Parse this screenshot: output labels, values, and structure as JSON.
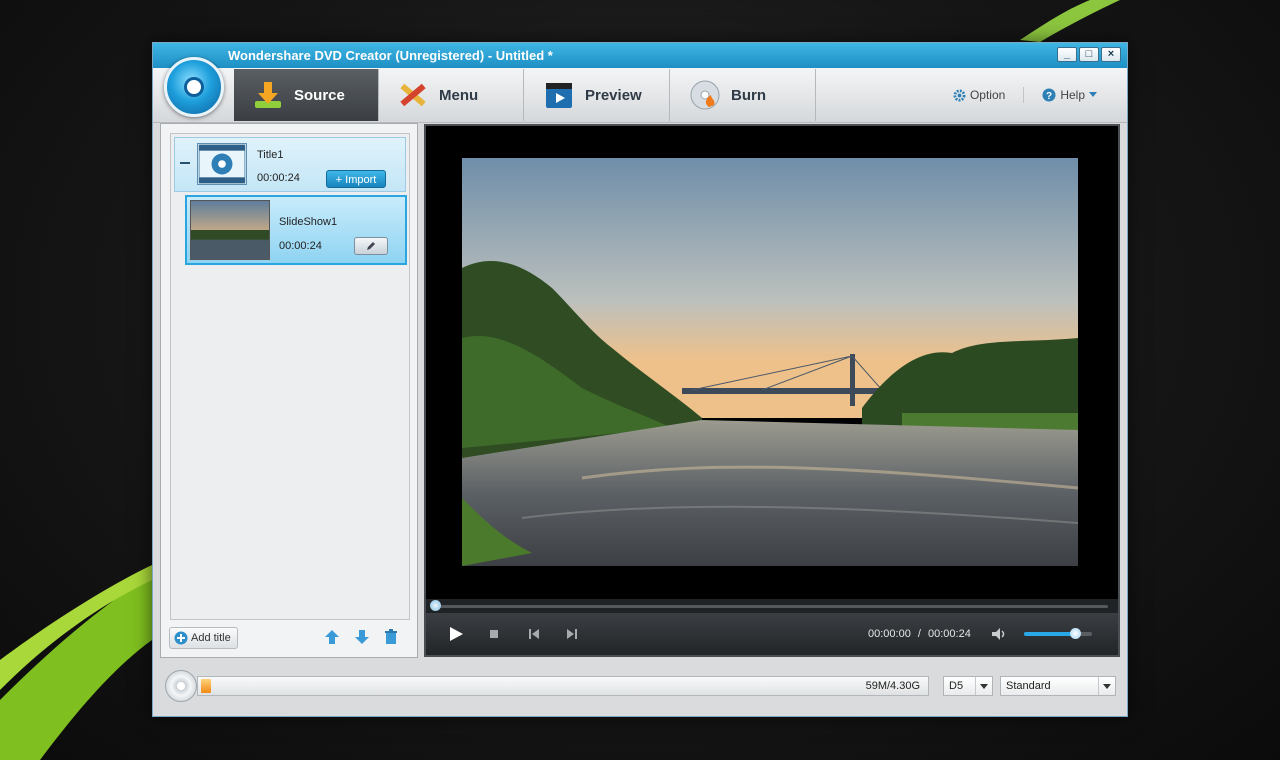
{
  "window": {
    "title": "Wondershare DVD Creator (Unregistered) - Untitled *",
    "controls": [
      "minimize",
      "maximize",
      "close"
    ]
  },
  "toolbar": {
    "tabs": [
      {
        "label": "Source",
        "icon": "download-arrow-icon",
        "active": true
      },
      {
        "label": "Menu",
        "icon": "pencil-ruler-icon",
        "active": false
      },
      {
        "label": "Preview",
        "icon": "clapperboard-play-icon",
        "active": false
      },
      {
        "label": "Burn",
        "icon": "disc-flame-icon",
        "active": false
      }
    ],
    "option_label": "Option",
    "help_label": "Help"
  },
  "source_list": {
    "title": {
      "name": "Title1",
      "duration": "00:00:24",
      "import_label": "+ Import"
    },
    "slideshow": {
      "name": "SlideShow1",
      "duration": "00:00:24"
    },
    "add_title_label": "Add title"
  },
  "player": {
    "current_time": "00:00:00",
    "separator": "/",
    "total_time": "00:00:24",
    "progress": 0,
    "volume": 0.75
  },
  "bottom": {
    "capacity_label": "59M/4.30G",
    "capacity_fraction": 0.0137,
    "disc_type": "D5",
    "quality": "Standard"
  },
  "colors": {
    "accent": "#1d8fc4",
    "active_tab": "#45494d",
    "capacity_fill": "#f08a14"
  }
}
